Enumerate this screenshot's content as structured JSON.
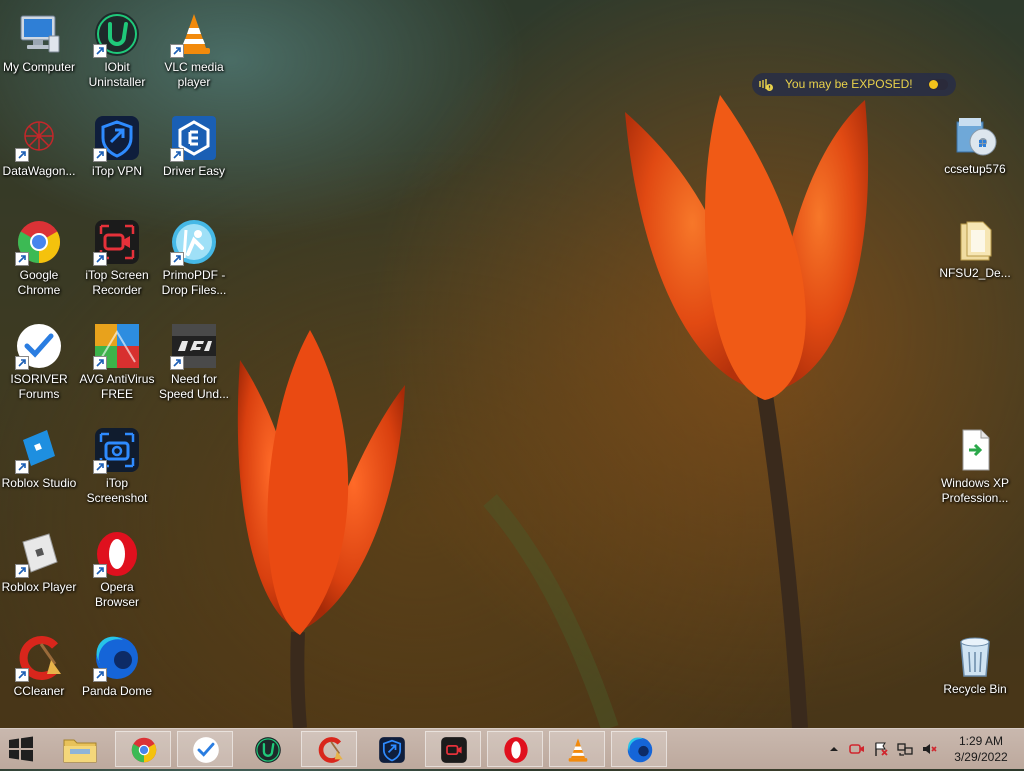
{
  "desktop": {
    "icons": [
      {
        "id": "my-computer",
        "label": "My Computer",
        "icon": "computer-icon"
      },
      {
        "id": "iobit-uninstaller",
        "label": "IObit Uninstaller",
        "icon": "iobit-uninstaller-icon"
      },
      {
        "id": "vlc-media-player",
        "label": "VLC media player",
        "icon": "vlc-cone-icon"
      },
      {
        "id": "datawagon",
        "label": "DataWagon...",
        "icon": "datawagon-icon"
      },
      {
        "id": "itop-vpn",
        "label": "iTop VPN",
        "icon": "itop-vpn-icon"
      },
      {
        "id": "driver-easy",
        "label": "Driver Easy",
        "icon": "driver-easy-icon"
      },
      {
        "id": "google-chrome",
        "label": "Google Chrome",
        "icon": "chrome-icon"
      },
      {
        "id": "itop-screen-recorder",
        "label": "iTop Screen Recorder",
        "icon": "screen-recorder-icon"
      },
      {
        "id": "primopdf",
        "label": "PrimoPDF - Drop Files...",
        "icon": "primopdf-icon"
      },
      {
        "id": "isoriver-forums",
        "label": "ISORIVER Forums",
        "icon": "isoriver-icon"
      },
      {
        "id": "avg-antivirus",
        "label": "AVG AntiVirus FREE",
        "icon": "avg-icon"
      },
      {
        "id": "need-for-speed",
        "label": "Need for Speed Und...",
        "icon": "nfs-icon"
      },
      {
        "id": "roblox-studio",
        "label": "Roblox Studio",
        "icon": "roblox-studio-icon"
      },
      {
        "id": "itop-screenshot",
        "label": "iTop Screenshot",
        "icon": "camera-icon"
      },
      {
        "id": "roblox-player",
        "label": "Roblox Player",
        "icon": "roblox-player-icon"
      },
      {
        "id": "opera-browser",
        "label": "Opera Browser",
        "icon": "opera-icon"
      },
      {
        "id": "ccleaner",
        "label": "CCleaner",
        "icon": "ccleaner-icon"
      },
      {
        "id": "panda-dome",
        "label": "Panda Dome",
        "icon": "panda-dome-icon"
      },
      {
        "id": "ccsetup576",
        "label": "ccsetup576",
        "icon": "installer-icon"
      },
      {
        "id": "nfsu2-de",
        "label": "NFSU2_De...",
        "icon": "folder-icon"
      },
      {
        "id": "windows-xp",
        "label": "Windows XP Profession...",
        "icon": "document-icon"
      },
      {
        "id": "recycle-bin",
        "label": "Recycle Bin",
        "icon": "recycle-bin-icon"
      }
    ]
  },
  "exposed_banner": {
    "text": "You may be EXPOSED!",
    "icon": "itop-vpn-shield-icon",
    "toggle_on": true,
    "accent": "#e9d24b"
  },
  "taskbar": {
    "start_icon": "windows-logo-icon",
    "pinned": [
      {
        "name": "file-explorer",
        "icon": "folder-icon"
      },
      {
        "name": "google-chrome",
        "icon": "chrome-icon"
      },
      {
        "name": "isoriver",
        "icon": "isoriver-icon"
      },
      {
        "name": "iobit-uninstaller",
        "icon": "iobit-uninstaller-icon"
      },
      {
        "name": "ccleaner",
        "icon": "ccleaner-icon"
      },
      {
        "name": "itop-vpn",
        "icon": "itop-vpn-icon"
      },
      {
        "name": "itop-screen-recorder",
        "icon": "screen-recorder-icon"
      },
      {
        "name": "opera",
        "icon": "opera-icon"
      },
      {
        "name": "vlc",
        "icon": "vlc-cone-icon"
      },
      {
        "name": "panda-dome",
        "icon": "panda-dome-icon"
      }
    ],
    "tray": [
      {
        "name": "show-hidden-icons",
        "icon": "chevron-up-icon"
      },
      {
        "name": "screen-recorder-tray",
        "icon": "screen-recorder-icon"
      },
      {
        "name": "action-center",
        "icon": "flag-icon"
      },
      {
        "name": "network",
        "icon": "network-icon"
      },
      {
        "name": "volume",
        "icon": "speaker-muted-icon"
      }
    ],
    "clock": {
      "time": "1:29 AM",
      "date": "3/29/2022"
    }
  }
}
